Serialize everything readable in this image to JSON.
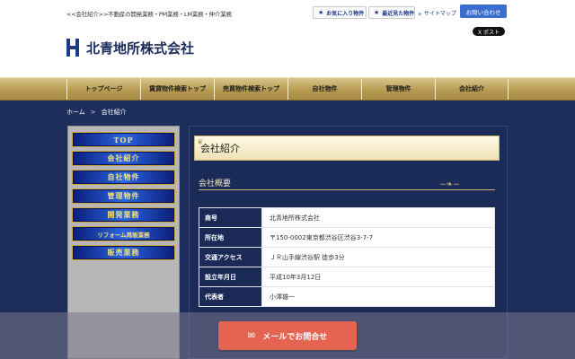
{
  "header": {
    "tagline": "<<会社紹介>>不動産の開発業務・PM業務・LM業務・仲介業務",
    "company_name": "北青地所株式会社",
    "buttons": {
      "favorites": "お気に入り物件",
      "recent": "最近見た物件",
      "sitemap": "サイトマップ",
      "contact": "お問い合わせ",
      "post": "X ポスト"
    }
  },
  "nav": {
    "items": [
      "トップページ",
      "賃貸物件検索トップ",
      "売買物件検索トップ",
      "自社物件",
      "管理物件",
      "会社紹介"
    ]
  },
  "breadcrumb": {
    "home": "ホーム",
    "separator": ">",
    "current": "会社紹介"
  },
  "sidebar": {
    "items": [
      "TOP",
      "会社紹介",
      "自社物件",
      "管理物件",
      "開発業務",
      "リフォーム再販業務",
      "販売業務"
    ]
  },
  "main": {
    "heading": "会社紹介",
    "section_title": "会社概要",
    "rows": [
      {
        "label": "商号",
        "value": "北青地所株式会社"
      },
      {
        "label": "所在地",
        "value": "〒150-0002東京都渋谷区渋谷3-7-7"
      },
      {
        "label": "交通アクセス",
        "value": "ＪＲ山手線渋谷駅 徒歩3分"
      },
      {
        "label": "設立年月日",
        "value": "平成10年3月12日"
      },
      {
        "label": "代表者",
        "value": "小澤雄一"
      }
    ]
  },
  "floating": {
    "mail_label": "メールでお問合せ"
  },
  "colors": {
    "page_bg": "#1d2e5c",
    "gold": "#b89b52",
    "accent_blue": "#3a6fd0",
    "mail_red": "#e46451"
  }
}
